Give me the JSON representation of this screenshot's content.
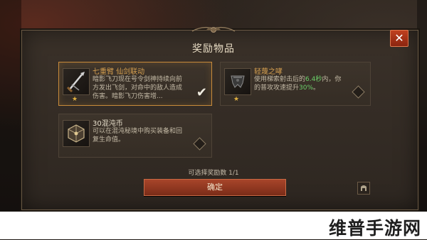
{
  "dialog": {
    "title": "奖励物品",
    "close_label": "✕"
  },
  "rewards": [
    {
      "name": "七重臂 仙剑联动",
      "description": "暗影飞刀现在号令剑神持续向前方发出飞剑，对命中的敌人造成伤害。暗影飞刀伤害增...",
      "icon": "dagger-icon",
      "rarity_stars": "★",
      "selected": true
    },
    {
      "name": "轻蔑之哮",
      "description_prefix": "使用梯索射击后的",
      "highlight_1": "6.4秒",
      "description_middle": "内，你的普攻攻速提升",
      "highlight_2": "30%",
      "description_suffix": "。",
      "icon": "armor-icon",
      "rarity_stars": "★",
      "selected": false
    },
    {
      "name": "30混沌币",
      "description": "可以在混沌秘境中购买装备和回复生命值。",
      "icon": "chaos-coin-icon",
      "selected": false
    }
  ],
  "selection_count": "可选择奖励数 1/1",
  "confirm_label": "确定",
  "watermark": "维普手游网",
  "colors": {
    "accent_red": "#a8452a",
    "selected_border": "#c88a3a",
    "highlight_green": "#6cd06a",
    "name_gold": "#d6a050"
  }
}
